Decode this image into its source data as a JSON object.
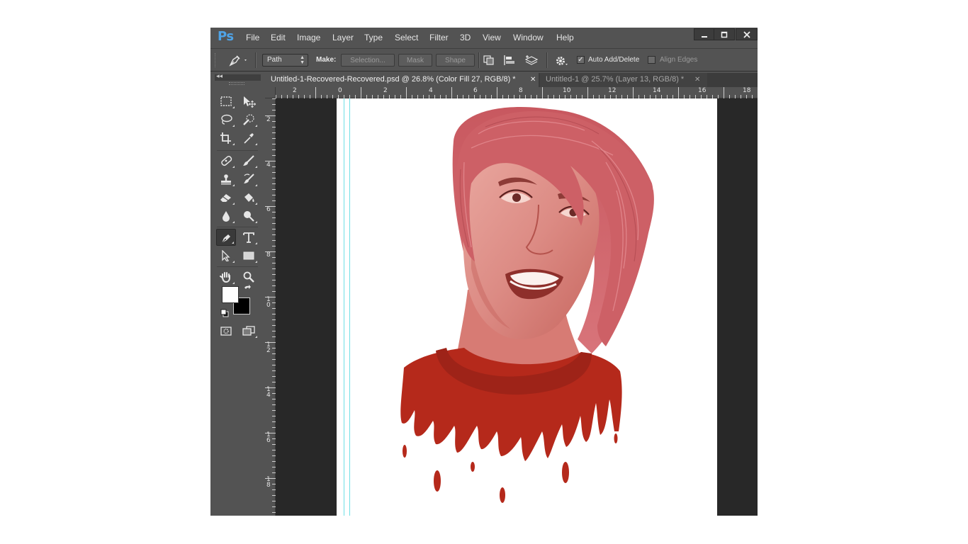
{
  "app": {
    "logo": "Ps"
  },
  "menu": [
    "File",
    "Edit",
    "Image",
    "Layer",
    "Type",
    "Select",
    "Filter",
    "3D",
    "View",
    "Window",
    "Help"
  ],
  "window_controls": {
    "minimize": "minimize-icon",
    "maximize": "maximize-icon",
    "close": "close-icon"
  },
  "options": {
    "mode_value": "Path",
    "make_label": "Make:",
    "selection_button": "Selection...",
    "mask_button": "Mask",
    "shape_button": "Shape",
    "auto_add_delete_label": "Auto Add/Delete",
    "auto_add_delete_checked": true,
    "align_edges_label": "Align Edges",
    "align_edges_checked": false
  },
  "tabs": [
    {
      "title": "Untitled-1-Recovered-Recovered.psd @ 26.8% (Color Fill 27, RGB/8) *",
      "active": true
    },
    {
      "title": "Untitled-1 @ 25.7% (Layer 13, RGB/8) *",
      "active": false
    }
  ],
  "ruler_top": [
    "2",
    "0",
    "2",
    "4",
    "6",
    "8",
    "10",
    "12",
    "14",
    "16",
    "18"
  ],
  "ruler_left": [
    "2",
    "4",
    "6",
    "8",
    "10",
    "12",
    "14",
    "16",
    "18"
  ],
  "toolbar": {
    "collapse_glyph": "◂◂",
    "active_tool": "pen-tool",
    "foreground_color": "#ffffff",
    "background_color": "#000000"
  },
  "canvas": {
    "artwork": "portrait illustration of smiling woman with red bob hair and dripping red shirt",
    "hair_color": "#c8585f",
    "skin_color": "#dc8b84",
    "shirt_color": "#b5291b"
  }
}
